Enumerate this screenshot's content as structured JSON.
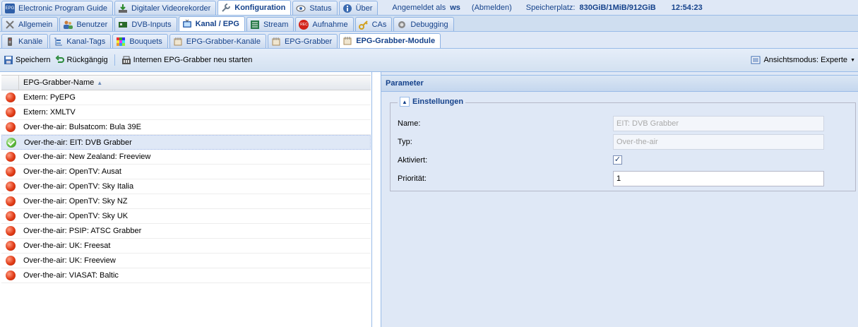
{
  "nav1": {
    "tabs": [
      {
        "label": "Electronic Program Guide",
        "icon": "epg-icon"
      },
      {
        "label": "Digitaler Videorekorder",
        "icon": "download-icon"
      },
      {
        "label": "Konfiguration",
        "icon": "wrench-icon",
        "active": true
      },
      {
        "label": "Status",
        "icon": "eye-icon"
      },
      {
        "label": "Über",
        "icon": "info-icon"
      }
    ],
    "logged_in_label": "Angemeldet als",
    "user": "ws",
    "logout": "(Abmelden)",
    "storage_label": "Speicherplatz:",
    "storage_value": "830GiB/1MiB/912GiB",
    "clock": "12:54:23"
  },
  "nav2": {
    "tabs": [
      {
        "label": "Allgemein",
        "icon": "tools-icon"
      },
      {
        "label": "Benutzer",
        "icon": "users-icon"
      },
      {
        "label": "DVB-Inputs",
        "icon": "card-icon"
      },
      {
        "label": "Kanal / EPG",
        "icon": "tv-icon",
        "active": true
      },
      {
        "label": "Stream",
        "icon": "stream-icon"
      },
      {
        "label": "Aufnahme",
        "icon": "rec-icon"
      },
      {
        "label": "CAs",
        "icon": "key-icon"
      },
      {
        "label": "Debugging",
        "icon": "bug-icon"
      }
    ]
  },
  "nav3": {
    "tabs": [
      {
        "label": "Kanäle",
        "icon": "remote-icon"
      },
      {
        "label": "Kanal-Tags",
        "icon": "tags-icon"
      },
      {
        "label": "Bouquets",
        "icon": "grid-icon"
      },
      {
        "label": "EPG-Grabber-Kanäle",
        "icon": "epg-grabber-icon"
      },
      {
        "label": "EPG-Grabber",
        "icon": "epg-grabber-icon"
      },
      {
        "label": "EPG-Grabber-Module",
        "icon": "epg-grabber-icon",
        "active": true
      }
    ]
  },
  "toolbar": {
    "save": "Speichern",
    "undo": "Rückgängig",
    "restart": "Internen EPG-Grabber neu starten",
    "view_mode": "Ansichtsmodus: Experte"
  },
  "grid": {
    "column_header": "EPG-Grabber-Name",
    "rows": [
      {
        "name": "Extern: PyEPG",
        "enabled": false
      },
      {
        "name": "Extern: XMLTV",
        "enabled": false
      },
      {
        "name": "Over-the-air: Bulsatcom: Bula 39E",
        "enabled": false
      },
      {
        "name": "Over-the-air: EIT: DVB Grabber",
        "enabled": true,
        "selected": true
      },
      {
        "name": "Over-the-air: New Zealand: Freeview",
        "enabled": false
      },
      {
        "name": "Over-the-air: OpenTV: Ausat",
        "enabled": false
      },
      {
        "name": "Over-the-air: OpenTV: Sky Italia",
        "enabled": false
      },
      {
        "name": "Over-the-air: OpenTV: Sky NZ",
        "enabled": false
      },
      {
        "name": "Over-the-air: OpenTV: Sky UK",
        "enabled": false
      },
      {
        "name": "Over-the-air: PSIP: ATSC Grabber",
        "enabled": false
      },
      {
        "name": "Over-the-air: UK: Freesat",
        "enabled": false
      },
      {
        "name": "Over-the-air: UK: Freeview",
        "enabled": false
      },
      {
        "name": "Over-the-air: VIASAT: Baltic",
        "enabled": false
      }
    ]
  },
  "params": {
    "title": "Parameter",
    "section": "Einstellungen",
    "name_label": "Name:",
    "name_value": "EIT: DVB Grabber",
    "type_label": "Typ:",
    "type_value": "Over-the-air",
    "enabled_label": "Aktiviert:",
    "enabled_checked": true,
    "priority_label": "Priorität:",
    "priority_value": "1"
  }
}
